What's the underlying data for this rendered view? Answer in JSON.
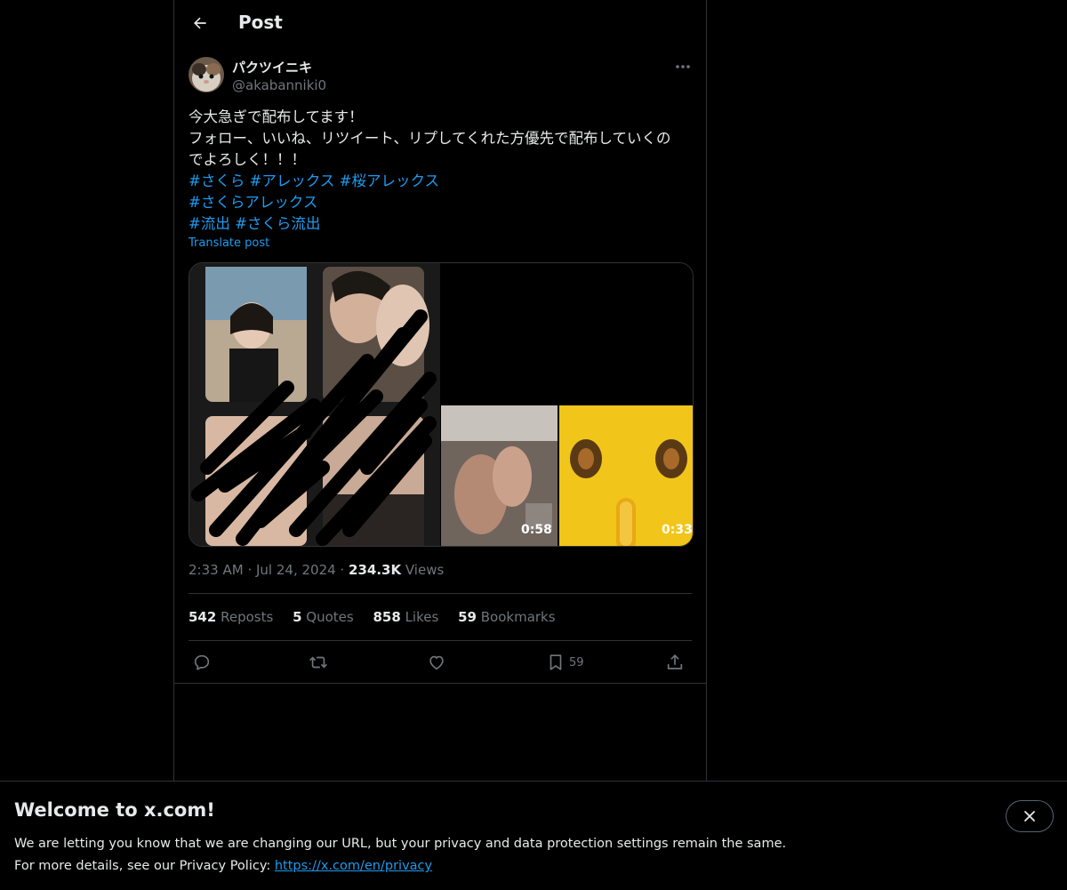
{
  "header": {
    "title": "Post"
  },
  "post": {
    "author_name": "パクツイニキ",
    "author_handle": "@akabanniki0",
    "text_lines": [
      "今大急ぎで配布してます！",
      "フォロー、いいね、リツイート、リプしてくれた方優先で配布していくの",
      "でよろしく！！！"
    ],
    "hashtags": [
      "#さくら",
      "#アレックス",
      "#桜アレックス",
      "#さくらアレックス",
      "#流出",
      "#さくら流出"
    ],
    "translate_label": "Translate post",
    "videos": [
      {
        "duration": "0:58"
      },
      {
        "duration": "0:33"
      }
    ],
    "time": "2:33 AM",
    "date": "Jul 24, 2024",
    "separator": "·",
    "views_count": "234.3K",
    "views_label": "Views"
  },
  "stats": {
    "reposts_count": "542",
    "reposts_label": "Reposts",
    "quotes_count": "5",
    "quotes_label": "Quotes",
    "likes_count": "858",
    "likes_label": "Likes",
    "bookmarks_count": "59",
    "bookmarks_label": "Bookmarks"
  },
  "actions": {
    "bookmark_count": "59",
    "icons": [
      "reply-icon",
      "repost-icon",
      "like-icon",
      "bookmark-icon",
      "share-icon"
    ]
  },
  "banner": {
    "title": "Welcome to x.com!",
    "line1": "We are letting you know that we are changing our URL, but your privacy and data protection settings remain the same.",
    "line2_prefix": "For more details, see our Privacy Policy: ",
    "link": "https://x.com/en/privacy"
  },
  "colors": {
    "background": "#000000",
    "text": "#e7e9ea",
    "secondary": "#71767b",
    "accent": "#1d9bf0",
    "border": "#2f3336"
  }
}
